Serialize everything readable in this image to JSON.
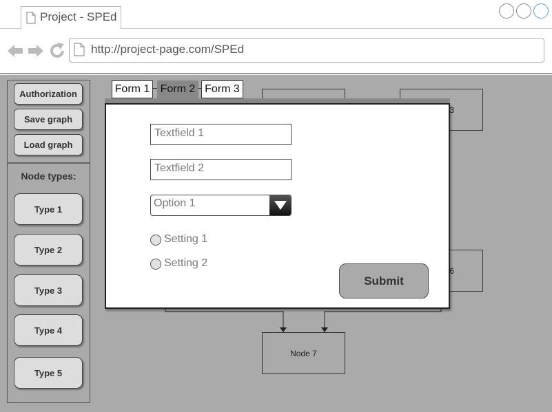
{
  "browser": {
    "tab_title": "Project - SPEd",
    "url": "http://project-page.com/SPEd",
    "accent_color": "#4aa3df"
  },
  "sidebar": {
    "actions": [
      {
        "label": "Authorization"
      },
      {
        "label": "Save graph"
      },
      {
        "label": "Load graph"
      }
    ],
    "node_types_label": "Node types:",
    "node_types": [
      {
        "label": "Type 1"
      },
      {
        "label": "Type 2"
      },
      {
        "label": "Type 3"
      },
      {
        "label": "Type 4"
      },
      {
        "label": "Type 5"
      }
    ]
  },
  "graph": {
    "nodes": [
      {
        "label": "3"
      },
      {
        "label": "6"
      },
      {
        "label": "Node 7"
      }
    ]
  },
  "form_tabs": [
    {
      "label": "Form 1",
      "active": false
    },
    {
      "label": "Form 2",
      "active": true
    },
    {
      "label": "Form 3",
      "active": false
    }
  ],
  "form": {
    "textfield1_placeholder": "Textfield 1",
    "textfield2_placeholder": "Textfield 2",
    "select_value": "Option 1",
    "settings": [
      {
        "label": "Setting 1"
      },
      {
        "label": "Setting 2"
      }
    ],
    "submit_label": "Submit"
  }
}
